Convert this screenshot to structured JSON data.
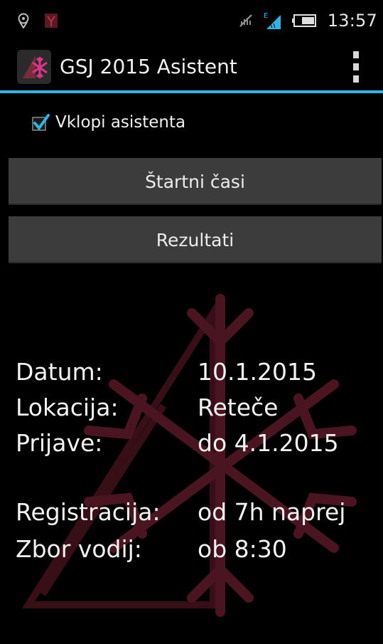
{
  "status_bar": {
    "time": "13:57",
    "icons": [
      "location-icon",
      "app-notification-icon",
      "no-signal-icon",
      "network-e-icon",
      "battery-icon"
    ]
  },
  "action_bar": {
    "title": "GSJ 2015 Asistent",
    "overflow_icon": "overflow-menu-icon",
    "divider_color": "#2fb4e6"
  },
  "assistant_toggle": {
    "label": "Vklopi asistenta",
    "checked": true,
    "check_color": "#2fb4e6"
  },
  "buttons": {
    "start_times": "Štartni časi",
    "results": "Rezultati"
  },
  "info": {
    "rows": [
      {
        "label": "Datum:",
        "value": "10.1.2015"
      },
      {
        "label": "Lokacija:",
        "value": "Reteče"
      },
      {
        "label": "Prijave:",
        "value": "do 4.1.2015"
      },
      {
        "label": "Registracija:",
        "value": "od 7h naprej"
      },
      {
        "label": "Zbor vodij:",
        "value": "ob 8:30"
      }
    ]
  },
  "colors": {
    "background": "#000000",
    "button_bg": "#3c3c3c",
    "watermark": "#4a1420"
  }
}
